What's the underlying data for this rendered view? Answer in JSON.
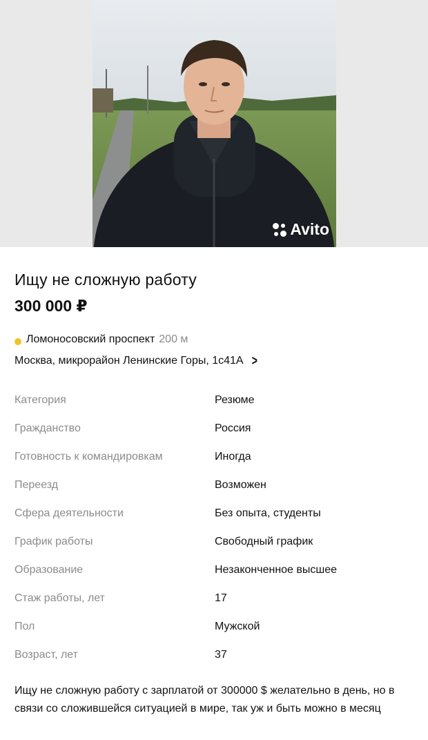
{
  "listing": {
    "watermark": "Avito",
    "title": "Ищу не сложную работу",
    "price": "300 000 ₽",
    "metro": {
      "station": "Ломоносовский проспект",
      "distance": "200 м",
      "line_color": "#f3c322"
    },
    "address": "Москва, микрорайон Ленинские Горы, 1с41А",
    "params": [
      {
        "label": "Категория",
        "value": "Резюме"
      },
      {
        "label": "Гражданство",
        "value": "Россия"
      },
      {
        "label": "Готовность к командировкам",
        "value": "Иногда"
      },
      {
        "label": "Переезд",
        "value": "Возможен"
      },
      {
        "label": "Сфера деятельности",
        "value": "Без опыта, студенты"
      },
      {
        "label": "График работы",
        "value": "Свободный график"
      },
      {
        "label": "Образование",
        "value": "Незаконченное высшее"
      },
      {
        "label": "Стаж работы, лет",
        "value": "17"
      },
      {
        "label": "Пол",
        "value": "Мужской"
      },
      {
        "label": "Возраст, лет",
        "value": "37"
      }
    ],
    "description": "Ищу не сложную работу с зарплатой от 300000 $ желательно в день, но в связи со сложившейся ситуацией в мире, так уж и быть можно  в месяц"
  }
}
